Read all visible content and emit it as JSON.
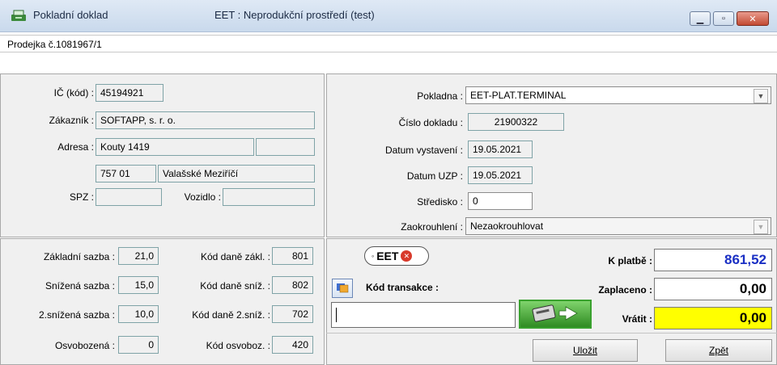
{
  "window": {
    "title": "Pokladní doklad",
    "environment": "EET : Neprodukční prostředí (test)"
  },
  "document": {
    "subtitle": "Prodejka č.1081967/1"
  },
  "customer": {
    "ic_label": "IČ  (kód) :",
    "ic_value": "45194921",
    "customer_label": "Zákazník :",
    "customer_value": "SOFTAPP, s. r. o.",
    "address_label": "Adresa :",
    "street": "Kouty 1419",
    "street_extra": "",
    "zip": "757 01",
    "city": "Valašské Meziříčí",
    "spz_label": "SPZ :",
    "spz_value": "",
    "vehicle_label": "Vozidlo :",
    "vehicle_value": ""
  },
  "register": {
    "pokladna_label": "Pokladna :",
    "pokladna_value": "EET-PLAT.TERMINAL",
    "doc_number_label": "Číslo dokladu :",
    "doc_number_value": "21900322",
    "issue_date_label": "Datum vystavení :",
    "issue_date_value": "19.05.2021",
    "uzp_label": "Datum UZP :",
    "uzp_value": "19.05.2021",
    "center_label": "Středisko :",
    "center_value": "0",
    "rounding_label": "Zaokrouhlení :",
    "rounding_value": "Nezaokrouhlovat"
  },
  "taxes": {
    "base_label": "Základní sazba :",
    "base_value": "21,0",
    "reduced_label": "Snížená sazba :",
    "reduced_value": "15,0",
    "reduced2_label": "2.snížená sazba :",
    "reduced2_value": "10,0",
    "exempt_label": "Osvobozená  :",
    "exempt_value": "0",
    "code_base_label": "Kód daně zákl. :",
    "code_base_value": "801",
    "code_reduced_label": "Kód daně sníž. :",
    "code_reduced_value": "802",
    "code_reduced2_label": "Kód daně 2.sníž. :",
    "code_reduced2_value": "702",
    "code_exempt_label": "Kód osvoboz. :",
    "code_exempt_value": "420"
  },
  "eet": {
    "badge": "EET",
    "transaction_label": "Kód transakce :",
    "transaction_value": ""
  },
  "payment": {
    "to_pay_label": "K platbě :",
    "to_pay_value": "861,52",
    "paid_label": "Zaplaceno :",
    "paid_value": "0,00",
    "return_label": "Vrátit :",
    "return_value": "0,00"
  },
  "actions": {
    "save": "Uložit",
    "back": "Zpět"
  },
  "colors": {
    "to_pay": "#1a2fc4",
    "return_bg": "#ffff00",
    "eet_red": "#d83a2c",
    "terminal_green": "#39a12e"
  }
}
